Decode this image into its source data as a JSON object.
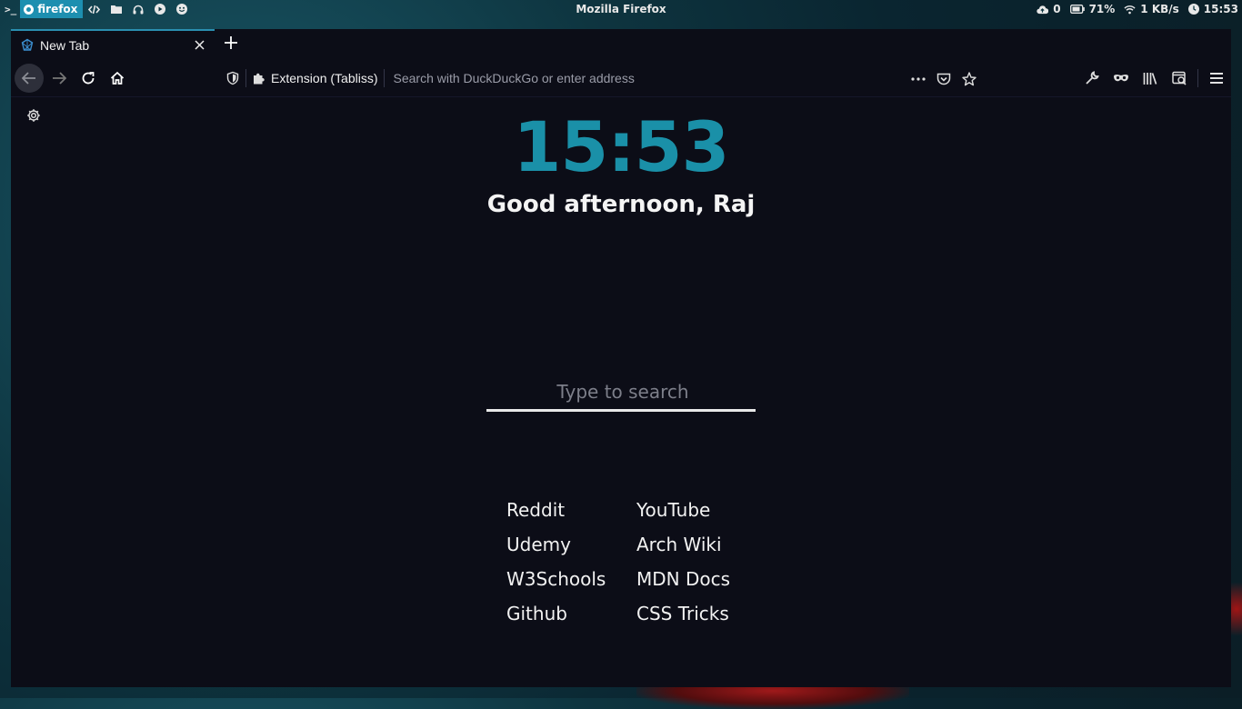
{
  "system_bar": {
    "terminal_icon": "terminal-icon",
    "active_app": "firefox",
    "window_title": "Mozilla Firefox",
    "cloud_count": "0",
    "battery": "71%",
    "network_speed": "1 KB/s",
    "clock": "15:53"
  },
  "browser": {
    "tab": {
      "title": "New Tab",
      "icon": "tabliss-icon"
    },
    "urlbar": {
      "extension_label": "Extension (Tabliss)",
      "placeholder": "Search with DuckDuckGo or enter address"
    }
  },
  "page": {
    "time": "15:53",
    "greeting": "Good afternoon, Raj",
    "search_placeholder": "Type to search",
    "links": [
      {
        "label": "Reddit"
      },
      {
        "label": "YouTube"
      },
      {
        "label": "Udemy"
      },
      {
        "label": "Arch Wiki"
      },
      {
        "label": "W3Schools"
      },
      {
        "label": "MDN Docs"
      },
      {
        "label": "Github"
      },
      {
        "label": "CSS Tricks"
      }
    ]
  },
  "colors": {
    "accent": "#1a90a8",
    "background": "#0c0d17",
    "chip": "#1d8fb0"
  }
}
